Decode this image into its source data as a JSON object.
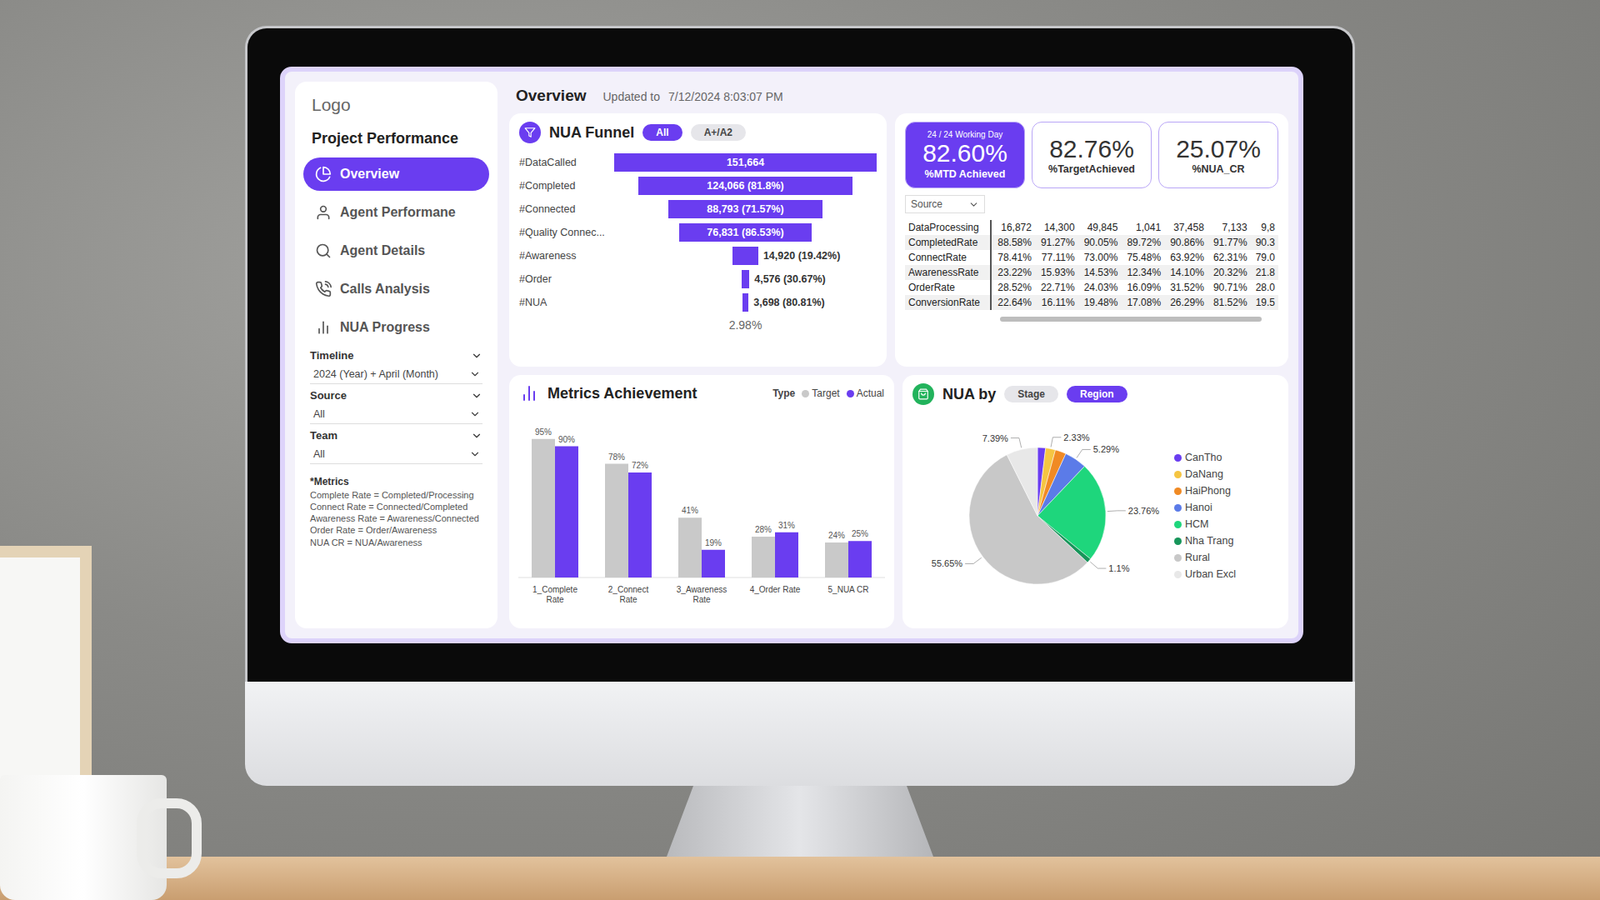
{
  "sidebar": {
    "logo": "Logo",
    "title": "Project Performance",
    "nav": [
      {
        "label": "Overview",
        "selected": true
      },
      {
        "label": "Agent Performane",
        "selected": false
      },
      {
        "label": "Agent Details",
        "selected": false
      },
      {
        "label": "Calls Analysis",
        "selected": false
      },
      {
        "label": "NUA Progress",
        "selected": false
      }
    ],
    "filters": [
      {
        "label": "Timeline",
        "value": "2024 (Year) + April (Month)"
      },
      {
        "label": "Source",
        "value": "All"
      },
      {
        "label": "Team",
        "value": "All"
      }
    ],
    "notes": {
      "title": "*Metrics",
      "lines": [
        "Complete Rate = Completed/Processing",
        "Connect Rate = Connected/Completed",
        "Awareness Rate = Awareness/Connected",
        "Order Rate = Order/Awareness",
        "NUA CR = NUA/Awareness"
      ]
    }
  },
  "header": {
    "title": "Overview",
    "updated": "Updated to",
    "timestamp": "7/12/2024 8:03:07 PM"
  },
  "funnel": {
    "title": "NUA Funnel",
    "toggles": [
      {
        "label": "All",
        "selected": true
      },
      {
        "label": "A+/A2",
        "selected": false
      }
    ],
    "stages": [
      {
        "label": "#DataCalled",
        "value": "151,664",
        "level": 1
      },
      {
        "label": "#Completed",
        "value": "124,066 (81.8%)",
        "level": 0.818
      },
      {
        "label": "#Connected",
        "value": "88,793 (71.57%)",
        "level": 0.585
      },
      {
        "label": "#Quality Connec...",
        "value": "76,831 (86.53%)",
        "level": 0.507
      },
      {
        "label": "#Awareness",
        "value": "14,920 (19.42%)",
        "level": 0.098
      },
      {
        "label": "#Order",
        "value": "4,576 (30.67%)",
        "level": 0.03
      },
      {
        "label": "#NUA",
        "value": "3,698 (80.81%)",
        "level": 0.024
      }
    ],
    "footer": "2.98%"
  },
  "kpis": [
    {
      "caption": "24 / 24 Working Day",
      "value": "82.60%",
      "label": "%MTD Achieved",
      "selected": true
    },
    {
      "value": "82.76%",
      "label": "%TargetAchieved",
      "selected": false
    },
    {
      "value": "25.07%",
      "label": "%NUA_CR",
      "selected": false
    }
  ],
  "table": {
    "filter": "Source",
    "rows": [
      {
        "label": "DataProcessing",
        "cells": [
          "16,872",
          "14,300",
          "49,845",
          "1,041",
          "37,458",
          "7,133",
          "9,8"
        ]
      },
      {
        "label": "CompletedRate",
        "cells": [
          "88.58%",
          "91.27%",
          "90.05%",
          "89.72%",
          "90.86%",
          "91.77%",
          "90.3"
        ]
      },
      {
        "label": "ConnectRate",
        "cells": [
          "78.41%",
          "77.11%",
          "73.00%",
          "75.48%",
          "63.92%",
          "62.31%",
          "79.0"
        ]
      },
      {
        "label": "AwarenessRate",
        "cells": [
          "23.22%",
          "15.93%",
          "14.53%",
          "12.34%",
          "14.10%",
          "20.32%",
          "21.8"
        ]
      },
      {
        "label": "OrderRate",
        "cells": [
          "28.52%",
          "22.71%",
          "24.03%",
          "16.09%",
          "31.52%",
          "90.71%",
          "28.0"
        ]
      },
      {
        "label": "ConversionRate",
        "cells": [
          "22.64%",
          "16.11%",
          "19.48%",
          "17.08%",
          "26.29%",
          "81.52%",
          "19.5"
        ]
      }
    ],
    "scrollbar": {
      "level": 0.81
    }
  },
  "metrics": {
    "title": "Metrics Achievement",
    "legendTitle": "Type",
    "legend": [
      {
        "label": "Target",
        "color": "#c9c9c9"
      },
      {
        "label": "Actual",
        "color": "#6a3df0"
      }
    ],
    "categories": [
      "1_Complete Rate",
      "2_Connect Rate",
      "3_Awareness Rate",
      "4_Order Rate",
      "5_NUA CR"
    ],
    "target": [
      95,
      78,
      41,
      28,
      24
    ],
    "actual": [
      90,
      72,
      19,
      31,
      25
    ],
    "targetLabels": [
      "95%",
      "78%",
      "41%",
      "28%",
      "24%"
    ],
    "actualLabels": [
      "90%",
      "72%",
      "19%",
      "31%",
      "25%"
    ]
  },
  "nua": {
    "title": "NUA by",
    "toggles": [
      {
        "label": "Stage",
        "selected": false
      },
      {
        "label": "Region",
        "selected": true
      }
    ],
    "regions": [
      {
        "name": "CanTho",
        "value": 1.9,
        "label": "",
        "color": "#6a3df0"
      },
      {
        "name": "DaNang",
        "value": 2.33,
        "label": "2.33%",
        "color": "#f5c542"
      },
      {
        "name": "HaiPhong",
        "value": 2.58,
        "label": "",
        "color": "#f08a24"
      },
      {
        "name": "Hanoi",
        "value": 5.29,
        "label": "5.29%",
        "color": "#5b7be8"
      },
      {
        "name": "HCM",
        "value": 23.76,
        "label": "23.76%",
        "color": "#1ed67c"
      },
      {
        "name": "Nha Trang",
        "value": 1.1,
        "label": "1.1%",
        "color": "#17955a"
      },
      {
        "name": "Rural",
        "value": 55.65,
        "label": "55.65%",
        "color": "#c8c8c8"
      },
      {
        "name": "Urban Excl",
        "value": 7.39,
        "label": "7.39%",
        "color": "#e8e8e8"
      }
    ]
  }
}
